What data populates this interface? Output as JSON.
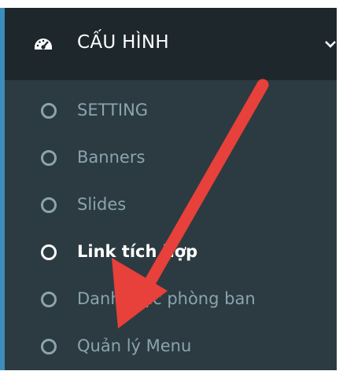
{
  "menu": {
    "section": {
      "title": "CẤU HÌNH",
      "icon": "dashboard-gauge-icon",
      "expand_icon": "chevron-down-icon"
    },
    "items": [
      {
        "label": "SETTING",
        "icon": "circle-outline-icon",
        "active": false
      },
      {
        "label": "Banners",
        "icon": "circle-outline-icon",
        "active": false
      },
      {
        "label": "Slides",
        "icon": "circle-outline-icon",
        "active": false
      },
      {
        "label": "Link tích hợp",
        "icon": "circle-outline-icon",
        "active": true
      },
      {
        "label": "Danh mục phòng ban",
        "icon": "circle-outline-icon",
        "active": false
      },
      {
        "label": "Quản lý Menu",
        "icon": "circle-outline-icon",
        "active": false
      }
    ]
  },
  "colors": {
    "header_bg": "#1e282c",
    "submenu_bg": "#2c3b41",
    "accent": "#3c8dbc",
    "item_text": "#8aa4af",
    "active_text": "#ffffff",
    "arrow": "#e8403a"
  }
}
